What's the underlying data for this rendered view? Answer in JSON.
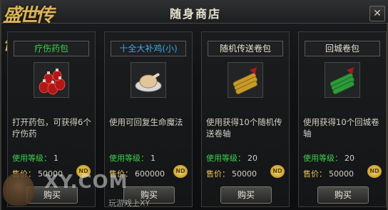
{
  "window": {
    "title": "随身商店",
    "close_label": "✕"
  },
  "logo": {
    "text": "盛世传奇"
  },
  "items": [
    {
      "name": "疗伤药包",
      "name_color": "#3cd24c",
      "icon": "red-potion-bottles-icon",
      "desc": "打开药包，可获得6个疗伤药",
      "level_label": "使用等级：",
      "level": "1",
      "price_label": "售价：",
      "price": "50000",
      "buy_label": "购买"
    },
    {
      "name": "十全大补鸡(小)",
      "name_color": "#3aa8e8",
      "icon": "roast-chicken-icon",
      "desc": "使用可回复生命魔法",
      "level_label": "使用等级：",
      "level": "1",
      "price_label": "售价：",
      "price": "600000",
      "buy_label": "购买"
    },
    {
      "name": "随机传送卷包",
      "name_color": "#e8e2cf",
      "icon": "gold-scroll-bundle-icon",
      "desc": "使用获得10个随机传送卷轴",
      "level_label": "使用等级：",
      "level": "20",
      "price_label": "售价：",
      "price": "50000",
      "buy_label": "购买"
    },
    {
      "name": "回城卷包",
      "name_color": "#e8e2cf",
      "icon": "green-scroll-bundle-icon",
      "desc": "使用获得10个回城卷轴",
      "level_label": "使用等级：",
      "level": "20",
      "price_label": "售价：",
      "price": "50000",
      "buy_label": "购买"
    }
  ],
  "currency_badge": "ND",
  "watermark": {
    "main": "XY.COM",
    "sub": "玩游戏上XY"
  }
}
